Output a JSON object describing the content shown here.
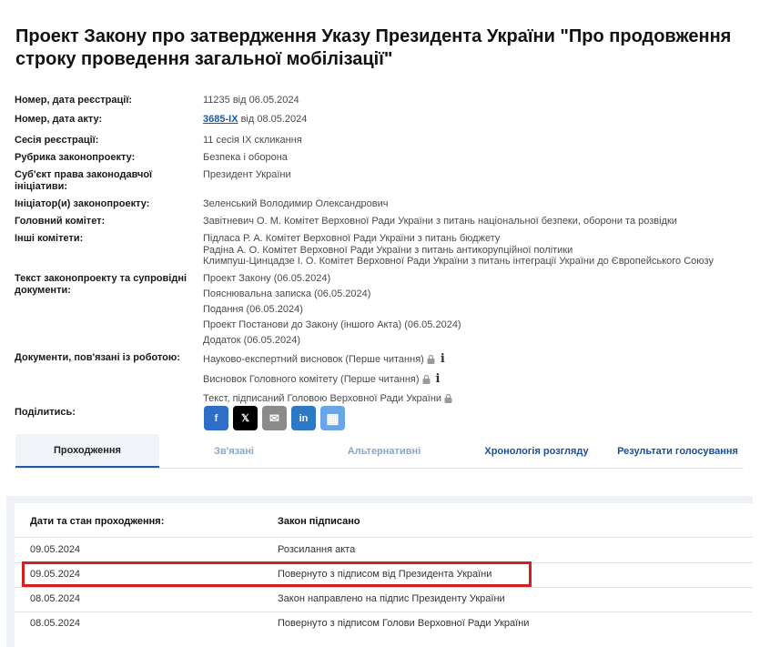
{
  "title": "Проект Закону про затвердження Указу Президента України \"Про продовження строку проведення загальної мобілізації\"",
  "fields": {
    "reg_label": "Номер, дата реєстрації:",
    "reg_value": "11235 від 06.05.2024",
    "act_label": "Номер, дата акту:",
    "act_number": "3685-IX",
    "act_date": " від 08.05.2024",
    "session_label": "Сесія реєстрації:",
    "session_value": "11 сесія IX скликання",
    "rubric_label": "Рубрика законопроекту:",
    "rubric_value": "Безпека і оборона",
    "subject_label": "Суб'єкт права законодавчої ініціативи:",
    "subject_value": "Президент України",
    "initiator_label": "Ініціатор(и) законопроекту:",
    "initiator_value": "Зеленський Володимир Олександрович",
    "main_committee_label": "Головний комітет:",
    "main_committee_value": "Завітневич О. М. Комітет Верховної Ради України з питань національної безпеки, оборони та розвідки",
    "other_committees_label": "Інші комітети:",
    "other_committees": [
      "Підласа Р. А. Комітет Верховної Ради України з питань бюджету",
      "Радіна А. О. Комітет Верховної Ради України з питань антикорупційної політики",
      "Климпуш-Цинцадзе І. О. Комітет Верховної Ради України з питань інтеграції України до Європейського Союзу"
    ],
    "docs_label": "Текст законопроекту та супровідні документи:",
    "docs": [
      "Проект Закону (06.05.2024)",
      "Пояснювальна записка (06.05.2024)",
      "Подання (06.05.2024)",
      "Проект Постанови до Закону (іншого Акта) (06.05.2024)",
      "Додаток (06.05.2024)"
    ],
    "related_label": "Документи, пов'язані із роботою:",
    "related": [
      "Науково-експертний висновок (Перше читання)",
      "Висновок Головного комітету (Перше читання)",
      "Текст, підписаний Головою Верховної Ради України"
    ],
    "share_label": "Поділитись:"
  },
  "share_icons": [
    {
      "name": "facebook",
      "glyph": "f",
      "color": "#2d6fc7"
    },
    {
      "name": "x",
      "glyph": "𝕏",
      "color": "#000000"
    },
    {
      "name": "email",
      "glyph": "✉",
      "color": "#8a8a8a"
    },
    {
      "name": "linkedin",
      "glyph": "in",
      "color": "#2d79c4"
    },
    {
      "name": "qr",
      "glyph": "▦",
      "color": "#6aa6e6"
    }
  ],
  "tabs": [
    {
      "label": "Проходження",
      "state": "active"
    },
    {
      "label": "Зв'язані",
      "state": "muted"
    },
    {
      "label": "Альтернативні",
      "state": "muted"
    },
    {
      "label": "Хронологія розгляду",
      "state": "blue"
    },
    {
      "label": "Результати голосування",
      "state": "blue"
    }
  ],
  "table": {
    "header": [
      "Дати та стан проходження:",
      "Закон підписано"
    ],
    "rows": [
      [
        "09.05.2024",
        "Розсилання акта"
      ],
      [
        "09.05.2024",
        "Повернуто з підписом від Президента України"
      ],
      [
        "08.05.2024",
        "Закон направлено на підпис Президенту України"
      ],
      [
        "08.05.2024",
        "Повернуто з підписом Голови Верховної Ради України"
      ]
    ]
  }
}
